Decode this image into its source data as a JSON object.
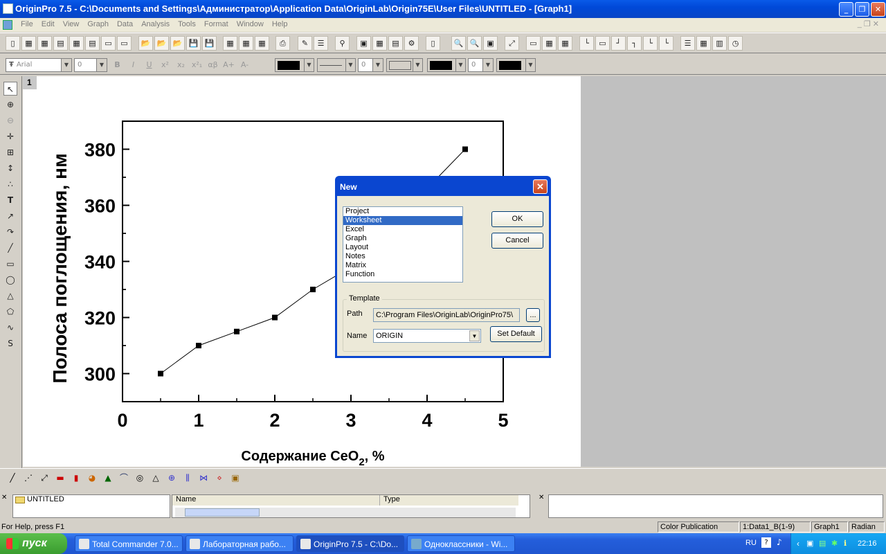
{
  "window": {
    "title": "OriginPro 7.5 - C:\\Documents and Settings\\Администратор\\Application Data\\OriginLab\\Origin75E\\User Files\\UNTITLED - [Graph1]",
    "controls": {
      "minimize": "_",
      "restore": "❐",
      "close": "✕"
    }
  },
  "menu": [
    "File",
    "Edit",
    "View",
    "Graph",
    "Data",
    "Analysis",
    "Tools",
    "Format",
    "Window",
    "Help"
  ],
  "format_toolbar": {
    "font": "Arial",
    "size": "0",
    "bold": "B",
    "italic": "I",
    "underline": "U",
    "superscript": "x²",
    "subscript": "x₂",
    "supsub": "x²₁",
    "greek": "αβ",
    "bigger": "A+",
    "smaller": "A-",
    "line_width": "0",
    "pattern_width": "0"
  },
  "graph": {
    "layer_label": "1",
    "ylabel": "Полоса поглощения, нм",
    "xlabel_main": "Содержание CeO",
    "xlabel_sub": "2",
    "xlabel_tail": ", %"
  },
  "chart_data": {
    "type": "line",
    "x": [
      0.5,
      1.0,
      1.5,
      2.0,
      2.5,
      3.0,
      4.5
    ],
    "y": [
      300,
      310,
      315,
      320,
      330,
      338,
      380
    ],
    "xlim": [
      0,
      5
    ],
    "ylim": [
      290,
      390
    ],
    "xticks": [
      "0",
      "1",
      "2",
      "3",
      "4",
      "5"
    ],
    "yticks": [
      "300",
      "320",
      "340",
      "360",
      "380"
    ],
    "xlabel": "Содержание CeO2, %",
    "ylabel": "Полоса поглощения, нм",
    "marker": "square",
    "line_color": "#000000",
    "grid": false
  },
  "dialog": {
    "title": "New",
    "types": [
      "Project",
      "Worksheet",
      "Excel",
      "Graph",
      "Layout",
      "Notes",
      "Matrix",
      "Function"
    ],
    "selected_type": "Worksheet",
    "ok": "OK",
    "cancel": "Cancel",
    "template_label": "Template",
    "path_label": "Path",
    "path_value": "C:\\Program Files\\OriginLab\\OriginPro75\\",
    "browse": "...",
    "name_label": "Name",
    "name_value": "ORIGIN",
    "set_default": "Set Default"
  },
  "explorer": {
    "folder": "UNTITLED",
    "col_name": "Name",
    "col_type": "Type"
  },
  "status": {
    "help": "For Help, press F1",
    "color_mode": "Color Publication",
    "active_data": "1:Data1_B(1-9)",
    "active_window": "Graph1",
    "angle_unit": "Radian"
  },
  "taskbar": {
    "start": "пуск",
    "tasks": [
      "Total Commander 7.0...",
      "Лабораторная рабо...",
      "OriginPro 7.5 - C:\\Do...",
      "Одноклассники - Wi..."
    ],
    "lang": "RU",
    "clock": "22:16"
  },
  "colors": {
    "selection": "#316ac5",
    "titlebar": "#0a46d0"
  }
}
